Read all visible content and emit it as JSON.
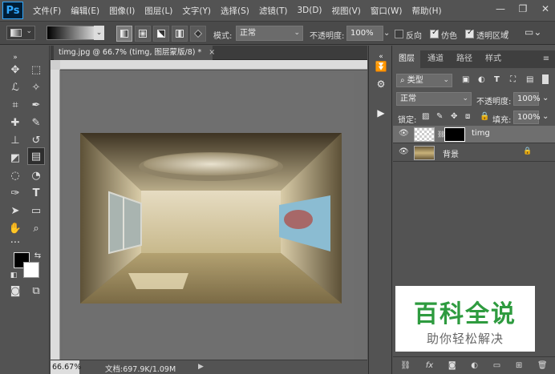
{
  "app": {
    "logo": "Ps"
  },
  "menu": [
    "文件(F)",
    "编辑(E)",
    "图像(I)",
    "图层(L)",
    "文字(Y)",
    "选择(S)",
    "滤镜(T)",
    "3D(D)",
    "视图(V)",
    "窗口(W)",
    "帮助(H)"
  ],
  "window_controls": {
    "minimize": "—",
    "restore": "❐",
    "close": "✕"
  },
  "options": {
    "mode_label": "模式:",
    "mode_value": "正常",
    "opacity_label": "不透明度:",
    "opacity_value": "100%",
    "reverse_label": "反向",
    "reverse_checked": false,
    "dither_label": "仿色",
    "dither_checked": true,
    "transparency_label": "透明区域",
    "transparency_checked": true
  },
  "document": {
    "tab_title": "timg.jpg @ 66.7% (timg, 图层蒙版/8) *",
    "tab_close": "×",
    "zoom": "66.67%",
    "doc_size": "文档:697.9K/1.09M",
    "status_arrow": "▶"
  },
  "panel": {
    "tabs": [
      "图层",
      "通道",
      "路径",
      "样式"
    ],
    "active_tab": "图层",
    "filter_label": "类型",
    "blend_mode": "正常",
    "opacity_label": "不透明度:",
    "opacity_value": "100%",
    "lock_label": "锁定:",
    "fill_label": "填充:",
    "fill_value": "100%"
  },
  "layers": [
    {
      "name": "timg",
      "active": true,
      "has_mask": true,
      "locked": false
    },
    {
      "name": "背景",
      "active": false,
      "has_mask": false,
      "locked": true
    }
  ],
  "watermark": {
    "title": "百科全说",
    "subtitle": "助你轻松解决"
  },
  "colors": {
    "accent_green": "#2e9b3f",
    "ps_blue": "#31a8ff",
    "panel_bg": "#535353"
  }
}
